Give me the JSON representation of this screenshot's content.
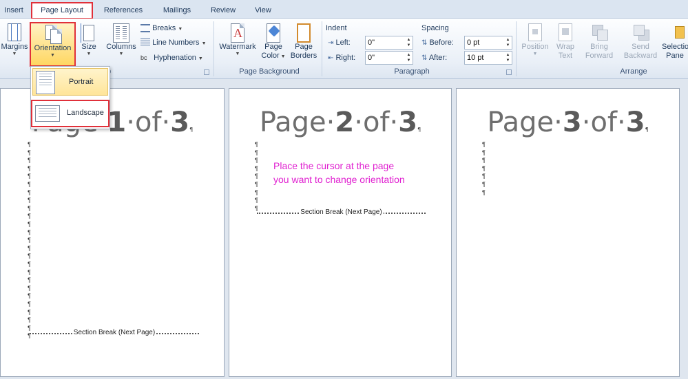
{
  "tabs": [
    "Insert",
    "Page Layout",
    "References",
    "Mailings",
    "Review",
    "View"
  ],
  "ribbon": {
    "page_setup": {
      "margins": "Margins",
      "orientation": "Orientation",
      "size": "Size",
      "columns": "Columns",
      "breaks": "Breaks",
      "line_numbers": "Line Numbers",
      "hyphenation": "Hyphenation",
      "group_label_partial": "up"
    },
    "page_background": {
      "watermark": "Watermark",
      "page_color_1": "Page",
      "page_color_2": "Color",
      "page_borders_1": "Page",
      "page_borders_2": "Borders",
      "group_label": "Page Background"
    },
    "paragraph": {
      "indent_label": "Indent",
      "left_label": "Left:",
      "left_value": "0\"",
      "right_label": "Right:",
      "right_value": "0\"",
      "spacing_label": "Spacing",
      "before_label": "Before:",
      "before_value": "0 pt",
      "after_label": "After:",
      "after_value": "10 pt",
      "group_label": "Paragraph"
    },
    "arrange": {
      "position": "Position",
      "wrap_1": "Wrap",
      "wrap_2": "Text",
      "bring_1": "Bring",
      "bring_2": "Forward",
      "send_1": "Send",
      "send_2": "Backward",
      "selection_1": "Selection",
      "selection_2": "Pane",
      "group_label": "Arrange"
    }
  },
  "orientation_menu": {
    "portrait": "Portrait",
    "landscape": "Landscape"
  },
  "pages": [
    {
      "prefix": "Page·",
      "num": "1",
      "mid": "·of·",
      "total": "3",
      "mark": "¶",
      "section_break": "Section Break (Next Page)"
    },
    {
      "prefix": "Page·",
      "num": "2",
      "mid": "·of·",
      "total": "3",
      "mark": "¶",
      "section_break": "Section Break (Next Page)",
      "note_line1": "Place the cursor at the page",
      "note_line2": "you want to change orientation"
    },
    {
      "prefix": "Page·",
      "num": "3",
      "mid": "·of·",
      "total": "3",
      "mark": "¶"
    }
  ],
  "colors": {
    "highlight_red": "#e0303a",
    "note_magenta": "#e020d0",
    "hover_yellow": "#ffe59a"
  }
}
